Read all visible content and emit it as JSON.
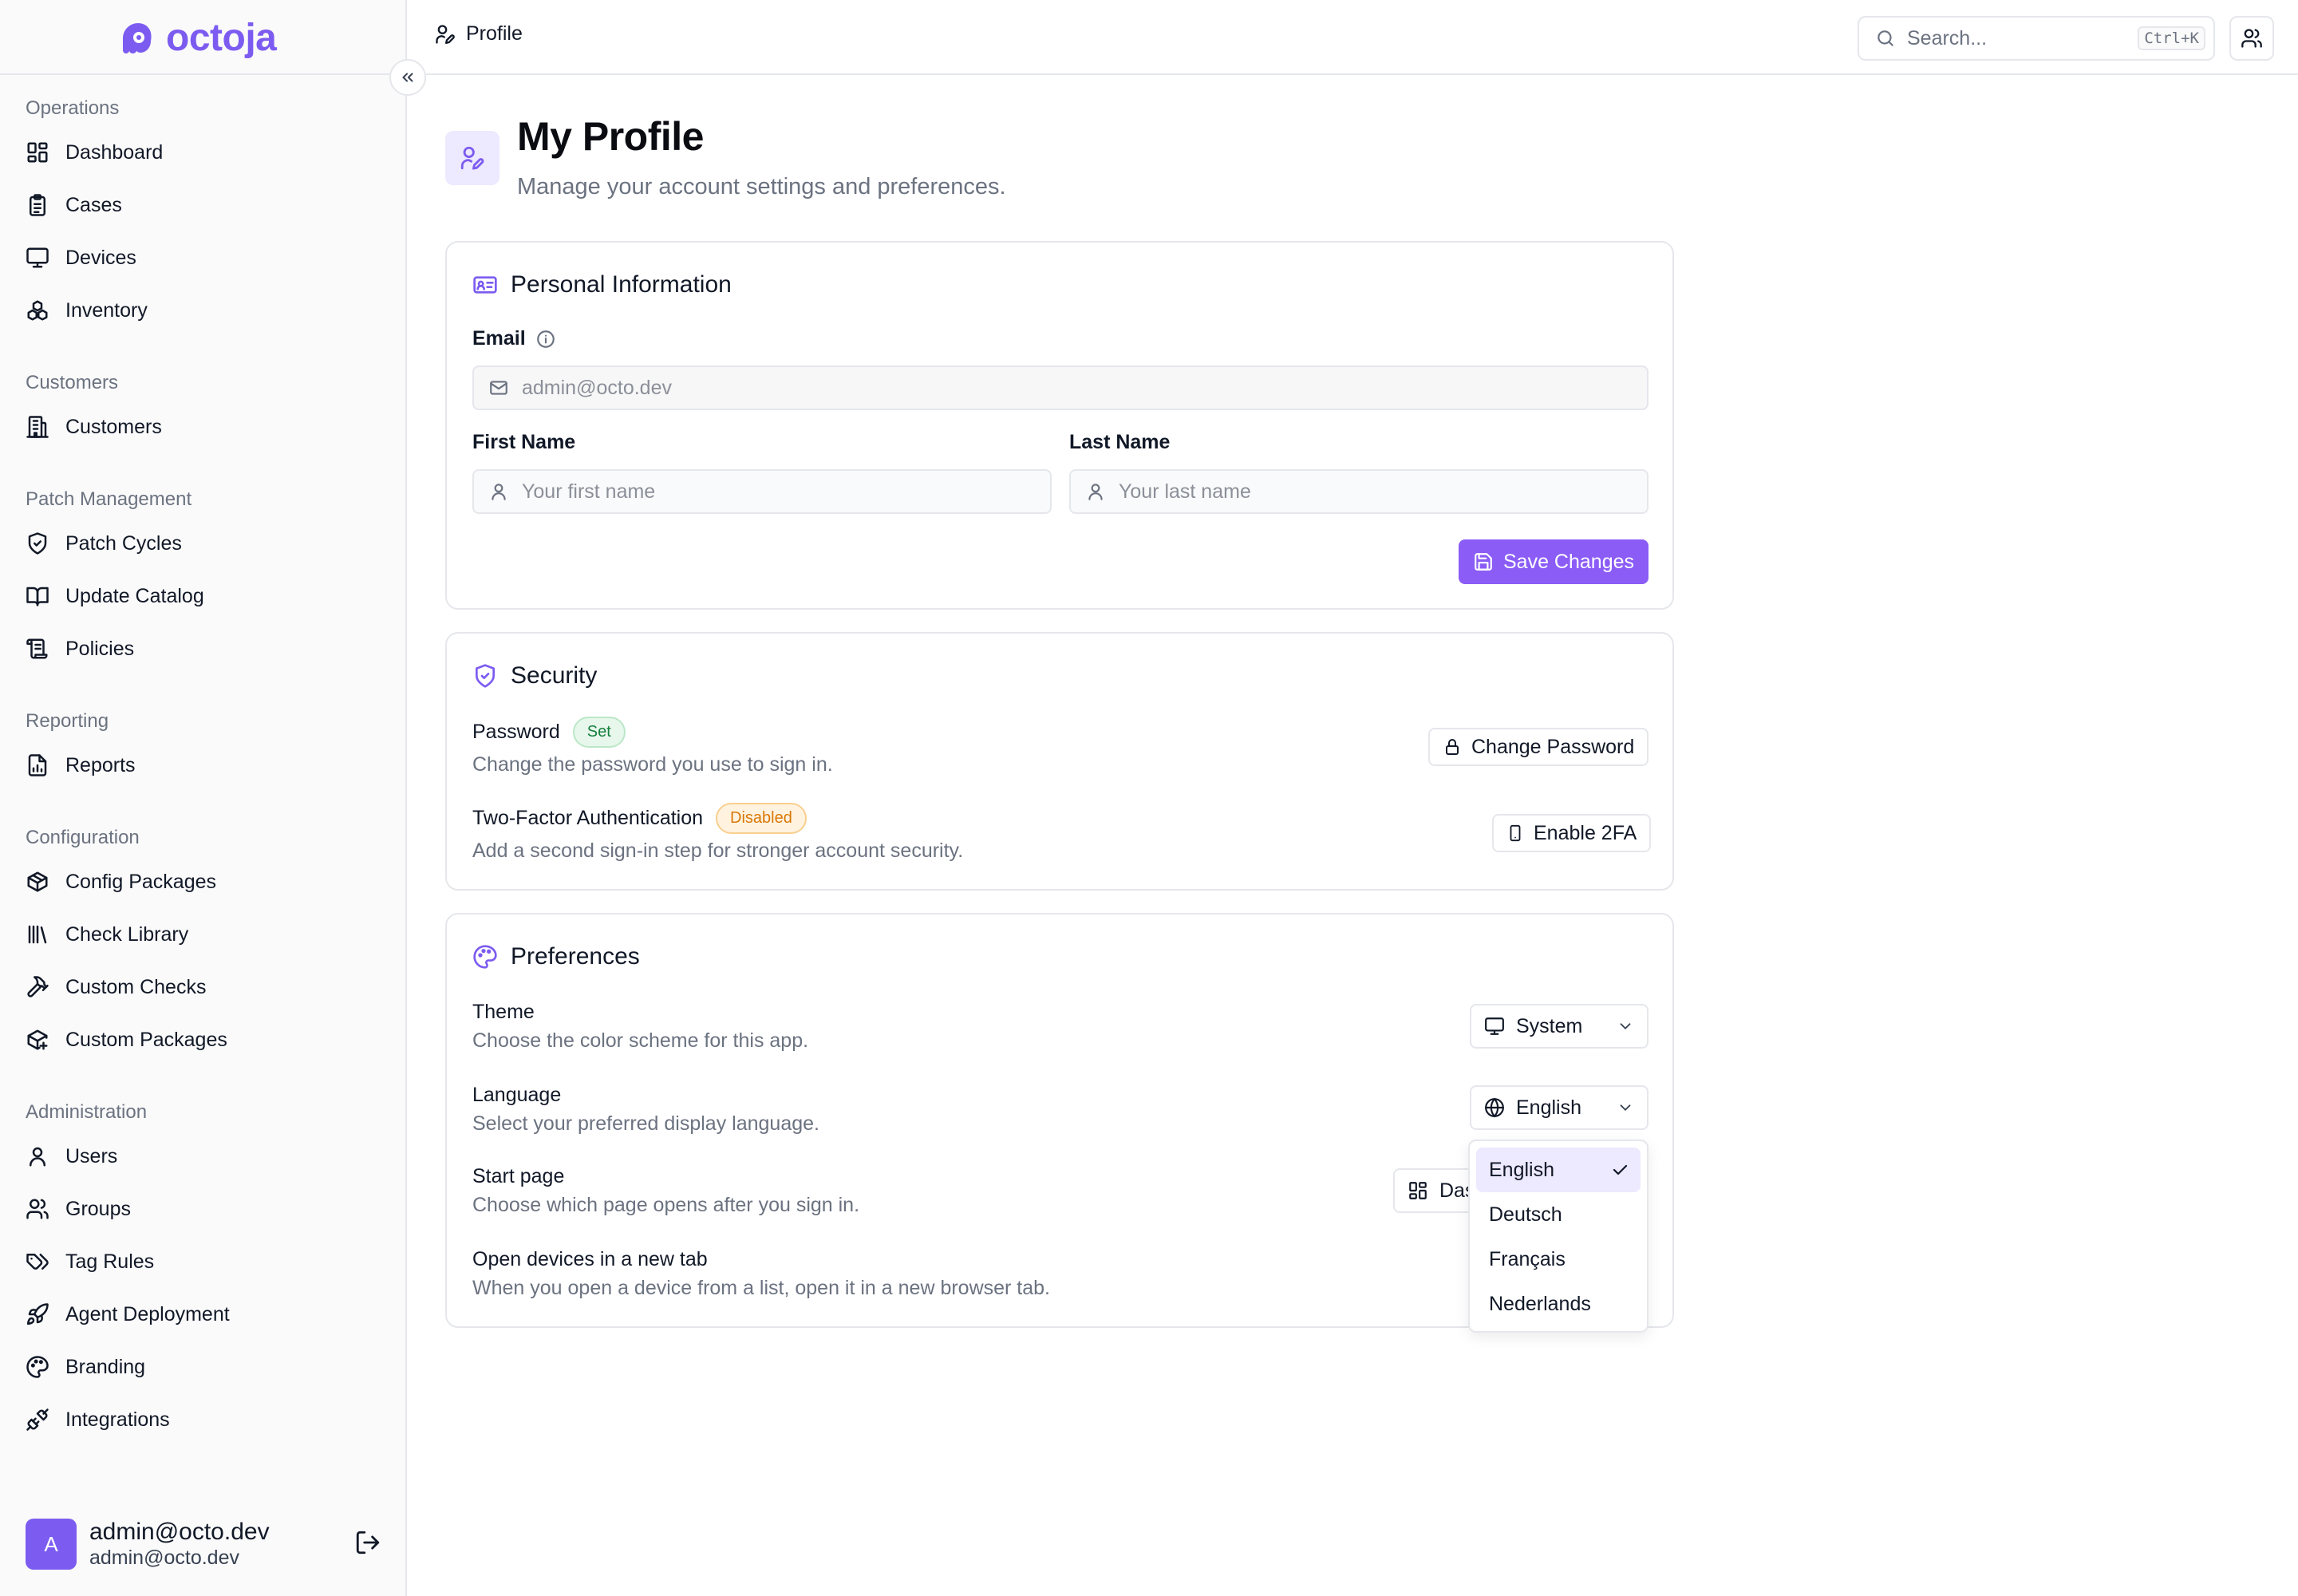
{
  "app": {
    "logo_text": "octoja",
    "brand_color": "#7c5cf0"
  },
  "topbar": {
    "breadcrumb": "Profile",
    "search_placeholder": "Search...",
    "search_shortcut": "Ctrl+K"
  },
  "sidebar": {
    "sections": [
      {
        "title": "Operations",
        "items": [
          {
            "label": "Dashboard",
            "icon": "dashboard-icon"
          },
          {
            "label": "Cases",
            "icon": "clipboard-icon"
          },
          {
            "label": "Devices",
            "icon": "monitor-icon"
          },
          {
            "label": "Inventory",
            "icon": "boxes-icon"
          }
        ]
      },
      {
        "title": "Customers",
        "items": [
          {
            "label": "Customers",
            "icon": "building-icon"
          }
        ]
      },
      {
        "title": "Patch Management",
        "items": [
          {
            "label": "Patch Cycles",
            "icon": "shield-check-icon"
          },
          {
            "label": "Update Catalog",
            "icon": "book-open-icon"
          },
          {
            "label": "Policies",
            "icon": "scroll-icon"
          }
        ]
      },
      {
        "title": "Reporting",
        "items": [
          {
            "label": "Reports",
            "icon": "file-chart-icon"
          }
        ]
      },
      {
        "title": "Configuration",
        "items": [
          {
            "label": "Config Packages",
            "icon": "package-icon"
          },
          {
            "label": "Check Library",
            "icon": "library-icon"
          },
          {
            "label": "Custom Checks",
            "icon": "hammer-icon"
          },
          {
            "label": "Custom Packages",
            "icon": "package-plus-icon"
          }
        ]
      },
      {
        "title": "Administration",
        "items": [
          {
            "label": "Users",
            "icon": "user-icon"
          },
          {
            "label": "Groups",
            "icon": "users-icon"
          },
          {
            "label": "Tag Rules",
            "icon": "tags-icon"
          },
          {
            "label": "Agent Deployment",
            "icon": "rocket-icon"
          },
          {
            "label": "Branding",
            "icon": "palette-icon"
          },
          {
            "label": "Integrations",
            "icon": "plug-icon"
          }
        ]
      }
    ],
    "user": {
      "avatar_letter": "A",
      "name": "admin@octo.dev",
      "email": "admin@octo.dev"
    }
  },
  "page": {
    "title": "My Profile",
    "subtitle": "Manage your account settings and preferences."
  },
  "personal": {
    "title": "Personal Information",
    "email_label": "Email",
    "email_value": "admin@octo.dev",
    "first_name_label": "First Name",
    "first_name_placeholder": "Your first name",
    "last_name_label": "Last Name",
    "last_name_placeholder": "Your last name",
    "save_label": "Save Changes"
  },
  "security": {
    "title": "Security",
    "password_label": "Password",
    "password_badge": "Set",
    "password_desc": "Change the password you use to sign in.",
    "change_password_label": "Change Password",
    "twofa_label": "Two-Factor Authentication",
    "twofa_badge": "Disabled",
    "twofa_desc": "Add a second sign-in step for stronger account security.",
    "enable_2fa_label": "Enable 2FA"
  },
  "preferences": {
    "title": "Preferences",
    "theme_label": "Theme",
    "theme_desc": "Choose the color scheme for this app.",
    "theme_value": "System",
    "language_label": "Language",
    "language_desc": "Select your preferred display language.",
    "language_value": "English",
    "start_page_label": "Start page",
    "start_page_desc": "Choose which page opens after you sign in.",
    "start_page_value_visible": "Das",
    "new_tab_label": "Open devices in a new tab",
    "new_tab_desc": "When you open a device from a list, open it in a new browser tab.",
    "language_options": [
      "English",
      "Deutsch",
      "Français",
      "Nederlands"
    ],
    "language_selected_index": 0
  }
}
